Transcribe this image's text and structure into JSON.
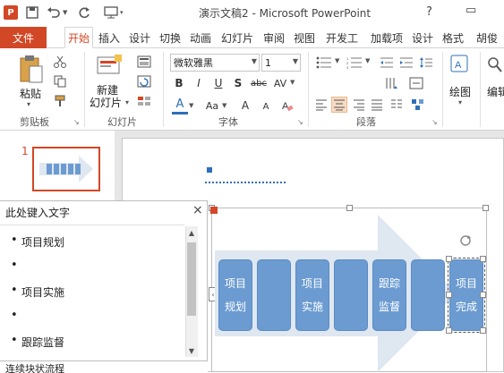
{
  "titlebar": {
    "app_logo": "P",
    "save_icon": "save-icon",
    "undo_icon": "undo-icon",
    "redo_icon": "redo-icon",
    "customize_icon": "customize-icon",
    "doc_title": "演示文稿2 - Microsoft PowerPoint",
    "help": "?",
    "restore": "▭"
  },
  "tabs": {
    "file": "文件",
    "items": [
      "开始",
      "插入",
      "设计",
      "切换",
      "动画",
      "幻灯片",
      "审阅",
      "视图",
      "开发工",
      "加载项",
      "设计",
      "格式",
      "胡俊"
    ],
    "active": "开始"
  },
  "ribbon": {
    "clipboard": {
      "paste": "粘贴",
      "label": "剪贴板"
    },
    "slides": {
      "new_slide_line1": "新建",
      "new_slide_line2": "幻灯片",
      "label": "幻灯片"
    },
    "font": {
      "font_name": "微软雅黑",
      "font_size": "1",
      "bold": "B",
      "italic": "I",
      "underline": "U",
      "shadow": "S",
      "strike": "abc",
      "spacing": "AV",
      "font_color": "A",
      "case": "Aa",
      "grow": "A",
      "shrink": "A",
      "label": "字体"
    },
    "paragraph": {
      "label": "段落"
    },
    "drawing": {
      "shape": "绘图",
      "edit": "编辑"
    }
  },
  "workspace": {
    "slide_number": "1",
    "text_pane": {
      "title": "此处键入文字",
      "close": "×",
      "bullets": [
        "项目规划",
        "",
        "项目实施",
        "",
        "跟踪监督"
      ],
      "footer": "连续块状流程"
    },
    "smartart": {
      "boxes": [
        {
          "line1": "项目",
          "line2": "规划"
        },
        {
          "line1": "",
          "line2": ""
        },
        {
          "line1": "项目",
          "line2": "实施"
        },
        {
          "line1": "",
          "line2": ""
        },
        {
          "line1": "跟踪",
          "line2": "监督"
        },
        {
          "line1": "",
          "line2": ""
        },
        {
          "line1": "项目",
          "line2": "完成"
        }
      ],
      "arrow_color": "#dfe7f1",
      "box_color": "#6b9bd1"
    }
  }
}
